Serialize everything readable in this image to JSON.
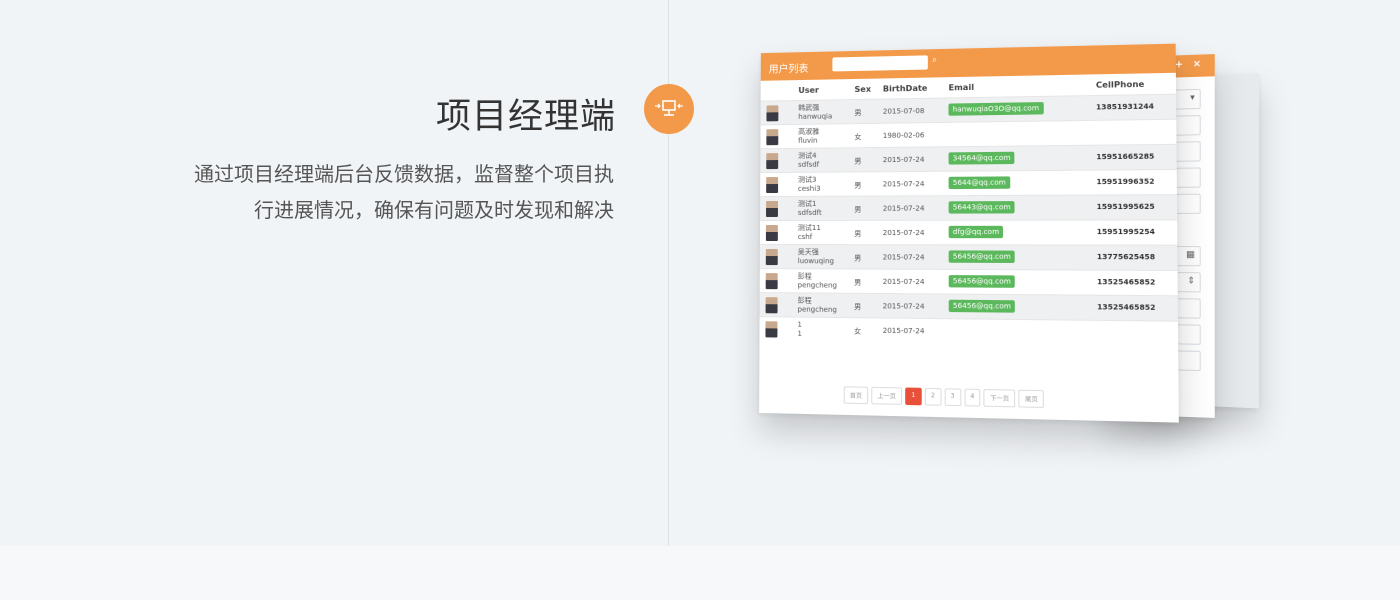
{
  "section": {
    "title": "项目经理端",
    "desc_line1": "通过项目经理端后台反馈数据，监督整个项目执",
    "desc_line2": "行进展情况，确保有问题及时发现和解决"
  },
  "badge": {
    "icon": "monitor-icon",
    "color": "#f39a4a"
  },
  "table_window": {
    "title": "用户列表",
    "columns": [
      "User",
      "Sex",
      "BirthDate",
      "Email",
      "CellPhone"
    ],
    "rows": [
      {
        "name1": "韩武强",
        "name2": "hanwuqia",
        "sex": "男",
        "birth": "2015-07-08",
        "email": "hanwuqiaO3O@qq.com",
        "phone": "13851931244"
      },
      {
        "name1": "高淑雅",
        "name2": "fluvin",
        "sex": "女",
        "birth": "1980-02-06",
        "email": "",
        "phone": ""
      },
      {
        "name1": "测试4",
        "name2": "sdfsdf",
        "sex": "男",
        "birth": "2015-07-24",
        "email": "34564@qq.com",
        "phone": "15951665285"
      },
      {
        "name1": "测试3",
        "name2": "ceshi3",
        "sex": "男",
        "birth": "2015-07-24",
        "email": "5644@qq.com",
        "phone": "15951996352"
      },
      {
        "name1": "测试1",
        "name2": "sdfsdft",
        "sex": "男",
        "birth": "2015-07-24",
        "email": "56443@qq.com",
        "phone": "15951995625"
      },
      {
        "name1": "测试11",
        "name2": "cshf",
        "sex": "男",
        "birth": "2015-07-24",
        "email": "dfg@qq.com",
        "phone": "15951995254"
      },
      {
        "name1": "吴天强",
        "name2": "luowuqing",
        "sex": "男",
        "birth": "2015-07-24",
        "email": "56456@qq.com",
        "phone": "13775625458"
      },
      {
        "name1": "彭程",
        "name2": "pengcheng",
        "sex": "男",
        "birth": "2015-07-24",
        "email": "56456@qq.com",
        "phone": "13525465852"
      },
      {
        "name1": "彭程",
        "name2": "pengcheng",
        "sex": "男",
        "birth": "2015-07-24",
        "email": "56456@qq.com",
        "phone": "13525465852"
      },
      {
        "name1": "1",
        "name2": "1",
        "sex": "女",
        "birth": "2015-07-24",
        "email": "",
        "phone": ""
      }
    ],
    "pager": [
      "首页",
      "上一页",
      "1",
      "2",
      "3",
      "4",
      "下一页",
      "尾页"
    ]
  },
  "form_window": {
    "add": "+",
    "close": "×"
  }
}
